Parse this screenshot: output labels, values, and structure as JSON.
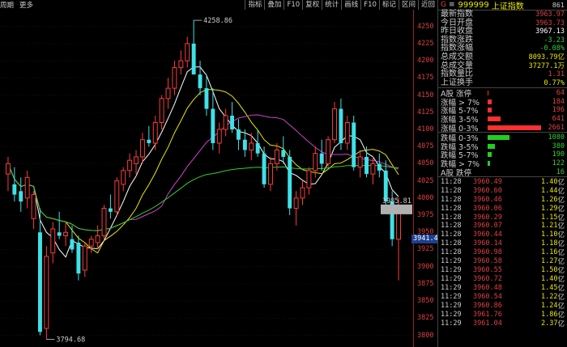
{
  "toolbar": {
    "period": "周期",
    "more": "更多",
    "buttons": [
      "指标",
      "叠加",
      "F10",
      "复权",
      "统计",
      "画线",
      "F10",
      "标记",
      "区间",
      "近回"
    ]
  },
  "chart_data": {
    "type": "candlestick",
    "ylim": [
      3790,
      4265
    ],
    "yticks": [
      3800,
      3825,
      3850,
      3875,
      3900,
      3925,
      3950,
      3975,
      4000,
      4025,
      4050,
      4075,
      4100,
      4125,
      4150,
      4175,
      4200,
      4225,
      4250
    ],
    "annotations": {
      "high_label": "4258.86",
      "low_label": "3794.68",
      "last_label": "3985.81",
      "current_price_label": "3941.4"
    },
    "candles": [
      {
        "o": 4035,
        "h": 4060,
        "l": 4010,
        "c": 4050
      },
      {
        "o": 4020,
        "h": 4045,
        "l": 3995,
        "c": 4005
      },
      {
        "o": 4010,
        "h": 4030,
        "l": 3980,
        "c": 3995
      },
      {
        "o": 4000,
        "h": 4040,
        "l": 3985,
        "c": 4030
      },
      {
        "o": 3970,
        "h": 4010,
        "l": 3955,
        "c": 4005
      },
      {
        "o": 3950,
        "h": 3985,
        "l": 3800,
        "c": 3805
      },
      {
        "o": 3810,
        "h": 3930,
        "l": 3794,
        "c": 3915
      },
      {
        "o": 3920,
        "h": 3965,
        "l": 3905,
        "c": 3955
      },
      {
        "o": 3950,
        "h": 3980,
        "l": 3940,
        "c": 3945
      },
      {
        "o": 3945,
        "h": 3965,
        "l": 3930,
        "c": 3950
      },
      {
        "o": 3940,
        "h": 3960,
        "l": 3920,
        "c": 3925
      },
      {
        "o": 3935,
        "h": 3945,
        "l": 3880,
        "c": 3890
      },
      {
        "o": 3895,
        "h": 3935,
        "l": 3885,
        "c": 3930
      },
      {
        "o": 3930,
        "h": 3945,
        "l": 3920,
        "c": 3940
      },
      {
        "o": 3935,
        "h": 3960,
        "l": 3925,
        "c": 3945
      },
      {
        "o": 3945,
        "h": 3990,
        "l": 3940,
        "c": 3985
      },
      {
        "o": 3985,
        "h": 4005,
        "l": 3970,
        "c": 3980
      },
      {
        "o": 3980,
        "h": 4030,
        "l": 3975,
        "c": 4025
      },
      {
        "o": 4020,
        "h": 4045,
        "l": 4010,
        "c": 4040
      },
      {
        "o": 4040,
        "h": 4065,
        "l": 4030,
        "c": 4055
      },
      {
        "o": 4050,
        "h": 4070,
        "l": 4035,
        "c": 4060
      },
      {
        "o": 4060,
        "h": 4095,
        "l": 4050,
        "c": 4085
      },
      {
        "o": 4085,
        "h": 4105,
        "l": 4075,
        "c": 4080
      },
      {
        "o": 4080,
        "h": 4120,
        "l": 4070,
        "c": 4110
      },
      {
        "o": 4110,
        "h": 4150,
        "l": 4100,
        "c": 4145
      },
      {
        "o": 4145,
        "h": 4175,
        "l": 4130,
        "c": 4160
      },
      {
        "o": 4160,
        "h": 4200,
        "l": 4150,
        "c": 4190
      },
      {
        "o": 4190,
        "h": 4215,
        "l": 4180,
        "c": 4200
      },
      {
        "o": 4200,
        "h": 4235,
        "l": 4190,
        "c": 4225
      },
      {
        "o": 4225,
        "h": 4259,
        "l": 4210,
        "c": 4180
      },
      {
        "o": 4180,
        "h": 4200,
        "l": 4150,
        "c": 4160
      },
      {
        "o": 4160,
        "h": 4180,
        "l": 4120,
        "c": 4130
      },
      {
        "o": 4130,
        "h": 4160,
        "l": 4070,
        "c": 4080
      },
      {
        "o": 4080,
        "h": 4110,
        "l": 4065,
        "c": 4100
      },
      {
        "o": 4100,
        "h": 4130,
        "l": 4090,
        "c": 4120
      },
      {
        "o": 4120,
        "h": 4140,
        "l": 4095,
        "c": 4100
      },
      {
        "o": 4100,
        "h": 4115,
        "l": 4070,
        "c": 4085
      },
      {
        "o": 4085,
        "h": 4100,
        "l": 4060,
        "c": 4070
      },
      {
        "o": 4070,
        "h": 4095,
        "l": 4055,
        "c": 4080
      },
      {
        "o": 4080,
        "h": 4100,
        "l": 4060,
        "c": 4065
      },
      {
        "o": 4065,
        "h": 4075,
        "l": 4015,
        "c": 4020
      },
      {
        "o": 4020,
        "h": 4060,
        "l": 4010,
        "c": 4050
      },
      {
        "o": 4050,
        "h": 4080,
        "l": 4040,
        "c": 4070
      },
      {
        "o": 4070,
        "h": 4090,
        "l": 4050,
        "c": 4060
      },
      {
        "o": 4060,
        "h": 4070,
        "l": 3975,
        "c": 3985
      },
      {
        "o": 3985,
        "h": 4010,
        "l": 3960,
        "c": 4000
      },
      {
        "o": 4000,
        "h": 4025,
        "l": 3990,
        "c": 4015
      },
      {
        "o": 4015,
        "h": 4045,
        "l": 4005,
        "c": 4040
      },
      {
        "o": 4040,
        "h": 4075,
        "l": 4030,
        "c": 4065
      },
      {
        "o": 4065,
        "h": 4085,
        "l": 4040,
        "c": 4050
      },
      {
        "o": 4050,
        "h": 4090,
        "l": 4045,
        "c": 4085
      },
      {
        "o": 4085,
        "h": 4140,
        "l": 4080,
        "c": 4130
      },
      {
        "o": 4130,
        "h": 4145,
        "l": 4070,
        "c": 4080
      },
      {
        "o": 4080,
        "h": 4120,
        "l": 4070,
        "c": 4110
      },
      {
        "o": 4110,
        "h": 4120,
        "l": 4040,
        "c": 4045
      },
      {
        "o": 4045,
        "h": 4070,
        "l": 4030,
        "c": 4060
      },
      {
        "o": 4060,
        "h": 4075,
        "l": 4030,
        "c": 4035
      },
      {
        "o": 4035,
        "h": 4060,
        "l": 4020,
        "c": 4050
      },
      {
        "o": 4050,
        "h": 4065,
        "l": 4030,
        "c": 4040
      },
      {
        "o": 4040,
        "h": 4055,
        "l": 3990,
        "c": 3995
      },
      {
        "o": 3995,
        "h": 4010,
        "l": 3930,
        "c": 3940
      },
      {
        "o": 3940,
        "h": 4000,
        "l": 3880,
        "c": 3985
      }
    ],
    "ma_lines": [
      {
        "name": "MA5",
        "color": "#ffffff"
      },
      {
        "name": "MA10",
        "color": "#e8e800"
      },
      {
        "name": "MA20",
        "color": "#d040d0"
      },
      {
        "name": "MA60",
        "color": "#30d030"
      }
    ]
  },
  "panel": {
    "marker": "G",
    "menu": "≡",
    "code": "999999",
    "name": "上证指数",
    "sn": "861",
    "quotes": [
      {
        "label": "最新指数",
        "value": "3963.97",
        "color": "#e04040"
      },
      {
        "label": "今日开盘",
        "value": "3963.73",
        "color": "#e04040"
      },
      {
        "label": "昨日收盘",
        "value": "3967.13",
        "color": "#ffffff"
      },
      {
        "label": "指数涨跌",
        "value": "-3.23",
        "color": "#30d030"
      },
      {
        "label": "指数涨幅",
        "value": "-0.08%",
        "color": "#30d030"
      },
      {
        "label": "总成交额",
        "value": "8093.79亿",
        "color": "#e8e800"
      },
      {
        "label": "总成交量",
        "value": "37277.1万",
        "color": "#e8e800"
      },
      {
        "label": "指数量比",
        "value": "1.31",
        "color": "#e04040"
      },
      {
        "label": "上证换手",
        "value": "0.77%",
        "color": "#e8e800"
      }
    ],
    "breadth_up": [
      {
        "label": "A股 涨停",
        "count": "64",
        "pct": 0.02
      },
      {
        "label": "涨幅 > 7%",
        "count": "184",
        "pct": 0.07
      },
      {
        "label": "涨幅 5-7%",
        "count": "196",
        "pct": 0.07
      },
      {
        "label": "涨幅 3-5%",
        "count": "641",
        "pct": 0.24
      },
      {
        "label": "涨幅 0-3%",
        "count": "2661",
        "pct": 1.0
      }
    ],
    "breadth_down": [
      {
        "label": "跌幅 0-3%",
        "count": "1080",
        "pct": 0.41
      },
      {
        "label": "跌幅 3-5%",
        "count": "380",
        "pct": 0.14
      },
      {
        "label": "跌幅 5-7%",
        "count": "190",
        "pct": 0.07
      },
      {
        "label": "跌幅 > 7%",
        "count": "122",
        "pct": 0.05
      },
      {
        "label": "A股 跌停",
        "count": "16",
        "pct": 0.0
      }
    ],
    "ticks": [
      {
        "time": "11:28",
        "price": "3960.49",
        "vol": "1.40",
        "unit": "亿"
      },
      {
        "time": "11:28",
        "price": "3960.60",
        "vol": "1.44",
        "unit": "亿"
      },
      {
        "time": "11:28",
        "price": "3960.46",
        "vol": "1.26",
        "unit": "亿"
      },
      {
        "time": "11:28",
        "price": "3960.06",
        "vol": "1.29",
        "unit": "亿"
      },
      {
        "time": "11:28",
        "price": "3960.29",
        "vol": "1.15",
        "unit": "亿"
      },
      {
        "time": "11:28",
        "price": "3960.07",
        "vol": "1.21",
        "unit": "亿"
      },
      {
        "time": "11:28",
        "price": "3960.44",
        "vol": "1.10",
        "unit": "亿"
      },
      {
        "time": "11:28",
        "price": "3960.14",
        "vol": "1.18",
        "unit": "亿"
      },
      {
        "time": "11:28",
        "price": "3960.98",
        "vol": "1.16",
        "unit": "亿"
      },
      {
        "time": "11:29",
        "price": "3960.58",
        "vol": "1.27",
        "unit": "亿"
      },
      {
        "time": "11:29",
        "price": "3960.55",
        "vol": "1.50",
        "unit": "亿"
      },
      {
        "time": "11:29",
        "price": "3960.72",
        "vol": "1.40",
        "unit": "亿"
      },
      {
        "time": "11:29",
        "price": "3960.48",
        "vol": "1.45",
        "unit": "亿"
      },
      {
        "time": "11:29",
        "price": "3960.54",
        "vol": "1.22",
        "unit": "亿"
      },
      {
        "time": "11:29",
        "price": "3960.86",
        "vol": "1.24",
        "unit": "亿"
      },
      {
        "time": "11:29",
        "price": "3961.76",
        "vol": "1.86",
        "unit": "亿"
      },
      {
        "time": "11:29",
        "price": "3961.04",
        "vol": "2.37",
        "unit": "亿"
      }
    ]
  }
}
